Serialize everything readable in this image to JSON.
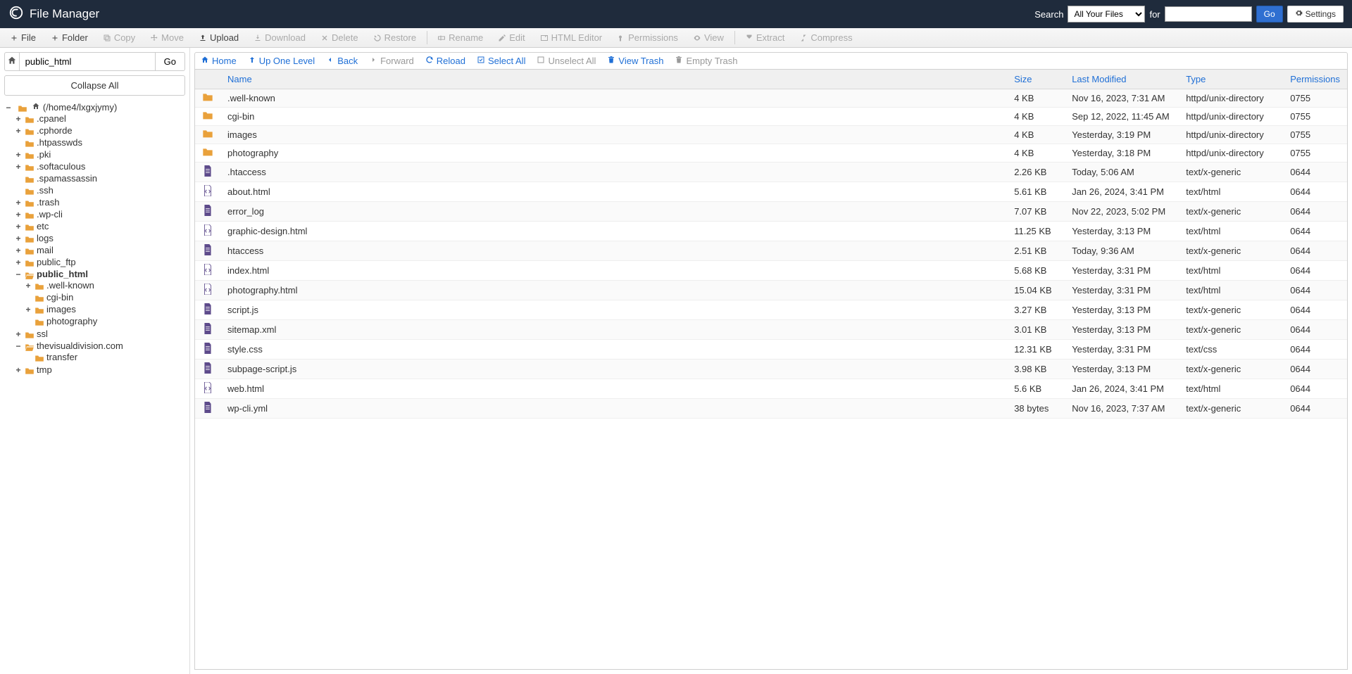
{
  "header": {
    "title": "File Manager",
    "search_label": "Search",
    "for_label": "for",
    "search_scope": "All Your Files",
    "go": "Go",
    "settings": "Settings"
  },
  "toolbar": [
    {
      "icon": "plus",
      "label": "File",
      "enabled": true
    },
    {
      "icon": "plus",
      "label": "Folder",
      "enabled": true
    },
    {
      "icon": "copy",
      "label": "Copy",
      "enabled": false
    },
    {
      "icon": "move",
      "label": "Move",
      "enabled": false
    },
    {
      "icon": "upload",
      "label": "Upload",
      "enabled": true
    },
    {
      "icon": "download",
      "label": "Download",
      "enabled": false
    },
    {
      "icon": "delete",
      "label": "Delete",
      "enabled": false
    },
    {
      "icon": "restore",
      "label": "Restore",
      "enabled": false
    },
    {
      "sep": true
    },
    {
      "icon": "rename",
      "label": "Rename",
      "enabled": false
    },
    {
      "icon": "edit",
      "label": "Edit",
      "enabled": false
    },
    {
      "icon": "htmleditor",
      "label": "HTML Editor",
      "enabled": false
    },
    {
      "icon": "permissions",
      "label": "Permissions",
      "enabled": false
    },
    {
      "icon": "view",
      "label": "View",
      "enabled": false
    },
    {
      "sep": true
    },
    {
      "icon": "extract",
      "label": "Extract",
      "enabled": false
    },
    {
      "icon": "compress",
      "label": "Compress",
      "enabled": false
    }
  ],
  "sidebar": {
    "path": "public_html",
    "go": "Go",
    "collapse": "Collapse All",
    "root_label": "(/home4/lxgxjymy)",
    "tree": [
      {
        "label": ".cpanel",
        "toggle": "+",
        "open": false,
        "depth": 1
      },
      {
        "label": ".cphorde",
        "toggle": "+",
        "open": false,
        "depth": 1
      },
      {
        "label": ".htpasswds",
        "toggle": "",
        "open": false,
        "depth": 1
      },
      {
        "label": ".pki",
        "toggle": "+",
        "open": false,
        "depth": 1
      },
      {
        "label": ".softaculous",
        "toggle": "+",
        "open": false,
        "depth": 1
      },
      {
        "label": ".spamassassin",
        "toggle": "",
        "open": false,
        "depth": 1
      },
      {
        "label": ".ssh",
        "toggle": "",
        "open": false,
        "depth": 1
      },
      {
        "label": ".trash",
        "toggle": "+",
        "open": false,
        "depth": 1
      },
      {
        "label": ".wp-cli",
        "toggle": "+",
        "open": false,
        "depth": 1
      },
      {
        "label": "etc",
        "toggle": "+",
        "open": false,
        "depth": 1
      },
      {
        "label": "logs",
        "toggle": "+",
        "open": false,
        "depth": 1
      },
      {
        "label": "mail",
        "toggle": "+",
        "open": false,
        "depth": 1
      },
      {
        "label": "public_ftp",
        "toggle": "+",
        "open": false,
        "depth": 1
      },
      {
        "label": "public_html",
        "toggle": "−",
        "open": true,
        "depth": 1,
        "bold": true
      },
      {
        "label": ".well-known",
        "toggle": "+",
        "open": false,
        "depth": 2
      },
      {
        "label": "cgi-bin",
        "toggle": "",
        "open": false,
        "depth": 2
      },
      {
        "label": "images",
        "toggle": "+",
        "open": false,
        "depth": 2
      },
      {
        "label": "photography",
        "toggle": "",
        "open": false,
        "depth": 2
      },
      {
        "label": "ssl",
        "toggle": "+",
        "open": false,
        "depth": 1
      },
      {
        "label": "thevisualdivision.com",
        "toggle": "−",
        "open": true,
        "depth": 1
      },
      {
        "label": "transfer",
        "toggle": "",
        "open": false,
        "depth": 2
      },
      {
        "label": "tmp",
        "toggle": "+",
        "open": false,
        "depth": 1
      }
    ]
  },
  "actions": {
    "home": "Home",
    "up": "Up One Level",
    "back": "Back",
    "forward": "Forward",
    "reload": "Reload",
    "select_all": "Select All",
    "unselect_all": "Unselect All",
    "view_trash": "View Trash",
    "empty_trash": "Empty Trash"
  },
  "table": {
    "headers": {
      "name": "Name",
      "size": "Size",
      "modified": "Last Modified",
      "type": "Type",
      "permissions": "Permissions"
    },
    "rows": [
      {
        "icon": "folder",
        "name": ".well-known",
        "size": "4 KB",
        "modified": "Nov 16, 2023, 7:31 AM",
        "type": "httpd/unix-directory",
        "perm": "0755"
      },
      {
        "icon": "folder",
        "name": "cgi-bin",
        "size": "4 KB",
        "modified": "Sep 12, 2022, 11:45 AM",
        "type": "httpd/unix-directory",
        "perm": "0755"
      },
      {
        "icon": "folder",
        "name": "images",
        "size": "4 KB",
        "modified": "Yesterday, 3:19 PM",
        "type": "httpd/unix-directory",
        "perm": "0755"
      },
      {
        "icon": "folder",
        "name": "photography",
        "size": "4 KB",
        "modified": "Yesterday, 3:18 PM",
        "type": "httpd/unix-directory",
        "perm": "0755"
      },
      {
        "icon": "doc",
        "name": ".htaccess",
        "size": "2.26 KB",
        "modified": "Today, 5:06 AM",
        "type": "text/x-generic",
        "perm": "0644"
      },
      {
        "icon": "html",
        "name": "about.html",
        "size": "5.61 KB",
        "modified": "Jan 26, 2024, 3:41 PM",
        "type": "text/html",
        "perm": "0644"
      },
      {
        "icon": "doc",
        "name": "error_log",
        "size": "7.07 KB",
        "modified": "Nov 22, 2023, 5:02 PM",
        "type": "text/x-generic",
        "perm": "0644"
      },
      {
        "icon": "html",
        "name": "graphic-design.html",
        "size": "11.25 KB",
        "modified": "Yesterday, 3:13 PM",
        "type": "text/html",
        "perm": "0644"
      },
      {
        "icon": "doc",
        "name": "htaccess",
        "size": "2.51 KB",
        "modified": "Today, 9:36 AM",
        "type": "text/x-generic",
        "perm": "0644"
      },
      {
        "icon": "html",
        "name": "index.html",
        "size": "5.68 KB",
        "modified": "Yesterday, 3:31 PM",
        "type": "text/html",
        "perm": "0644"
      },
      {
        "icon": "html",
        "name": "photography.html",
        "size": "15.04 KB",
        "modified": "Yesterday, 3:31 PM",
        "type": "text/html",
        "perm": "0644"
      },
      {
        "icon": "doc",
        "name": "script.js",
        "size": "3.27 KB",
        "modified": "Yesterday, 3:13 PM",
        "type": "text/x-generic",
        "perm": "0644"
      },
      {
        "icon": "doc",
        "name": "sitemap.xml",
        "size": "3.01 KB",
        "modified": "Yesterday, 3:13 PM",
        "type": "text/x-generic",
        "perm": "0644"
      },
      {
        "icon": "doc",
        "name": "style.css",
        "size": "12.31 KB",
        "modified": "Yesterday, 3:31 PM",
        "type": "text/css",
        "perm": "0644"
      },
      {
        "icon": "doc",
        "name": "subpage-script.js",
        "size": "3.98 KB",
        "modified": "Yesterday, 3:13 PM",
        "type": "text/x-generic",
        "perm": "0644"
      },
      {
        "icon": "html",
        "name": "web.html",
        "size": "5.6 KB",
        "modified": "Jan 26, 2024, 3:41 PM",
        "type": "text/html",
        "perm": "0644"
      },
      {
        "icon": "doc",
        "name": "wp-cli.yml",
        "size": "38 bytes",
        "modified": "Nov 16, 2023, 7:37 AM",
        "type": "text/x-generic",
        "perm": "0644"
      }
    ]
  }
}
